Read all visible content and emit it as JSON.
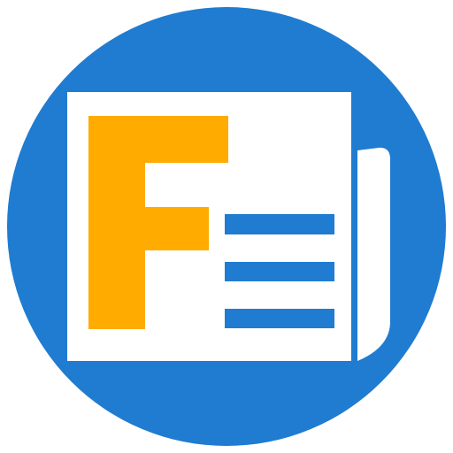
{
  "app_icon": {
    "name": "newspaper-app-logo",
    "letter": "F",
    "colors": {
      "circle": "#1f7cd1",
      "paper": "#ffffff",
      "letter": "#ffab00",
      "lines": "#1f7cd1"
    }
  }
}
